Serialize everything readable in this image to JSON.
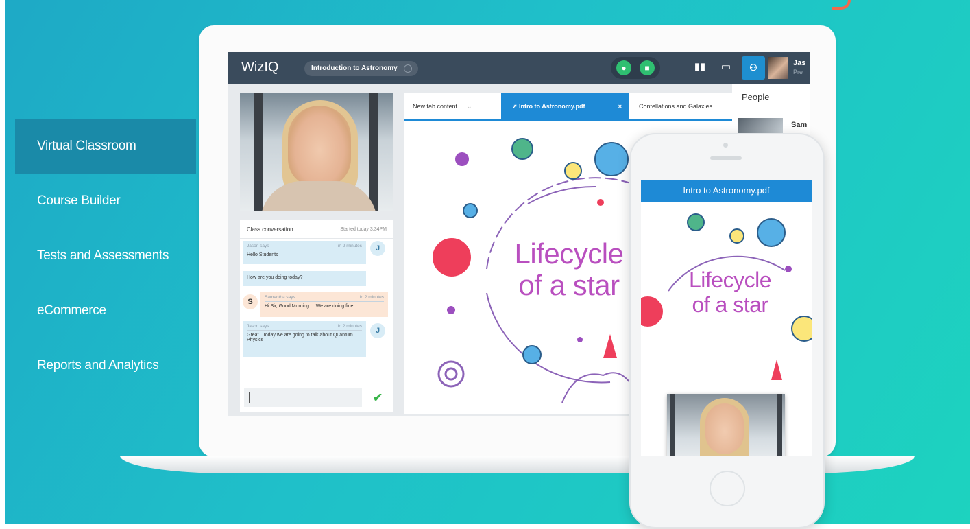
{
  "menu": {
    "items": [
      {
        "label": "Virtual Classroom",
        "active": true
      },
      {
        "label": "Course Builder",
        "active": false
      },
      {
        "label": "Tests and Assessments",
        "active": false
      },
      {
        "label": "eCommerce",
        "active": false
      },
      {
        "label": "Reports and Analytics",
        "active": false
      }
    ]
  },
  "app": {
    "logo": "WizIQ",
    "course_title": "Introduction to Astronomy",
    "user_name": "Jas",
    "user_role": "Pre"
  },
  "chat": {
    "title": "Class conversation",
    "started": "Started today 3:34PM",
    "messages": [
      {
        "author": "Jason says",
        "time": "in 2 minutes",
        "text": "Hello Students",
        "avatar": "J"
      },
      {
        "author": "",
        "time": "",
        "text": "How are you doing today?",
        "avatar": ""
      },
      {
        "author": "Samantha says",
        "time": "in 2 minutes",
        "text": "Hi Sir, Good Morning.....We are doing fine",
        "avatar": "S"
      },
      {
        "author": "Jason says",
        "time": "in 2 minutes",
        "text": "Great.. Today we are going to talk about Quantum Physics",
        "avatar": "J"
      }
    ]
  },
  "tabs": [
    {
      "label": "New tab content"
    },
    {
      "label": "Intro to Astronomy.pdf",
      "active": true
    },
    {
      "label": "Contellations and Galaxies"
    }
  ],
  "document": {
    "title_line1": "Lifecycle",
    "title_line2": "of a star"
  },
  "people": {
    "header": "People",
    "first_name": "Sam"
  },
  "phone": {
    "file_title": "Intro to Astronomy.pdf",
    "title_line1": "Lifecycle",
    "title_line2": "of a star"
  },
  "colors": {
    "accent_blue": "#1e8ad6",
    "title_purple": "#b94fbf",
    "active_menu": "#1a8aa8",
    "topbar": "#3a4b5c"
  }
}
